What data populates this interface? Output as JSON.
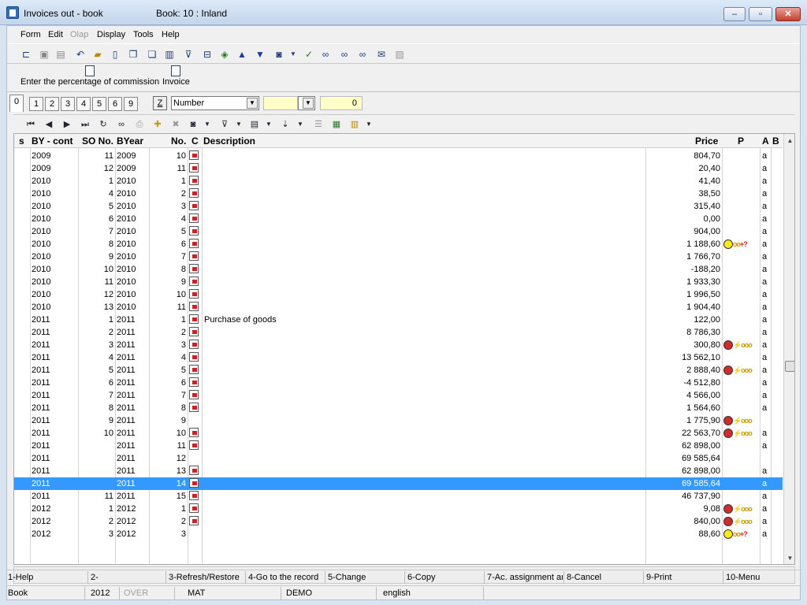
{
  "window": {
    "title": "Invoices out - book",
    "book": "Book: 10 : Inland",
    "min": "‒",
    "max": "▫",
    "close": "✕"
  },
  "menu": {
    "form": "Form",
    "edit": "Edit",
    "olap": "Olap",
    "display": "Display",
    "tools": "Tools",
    "help": "Help"
  },
  "actions": {
    "commission": "Enter the percentage of commission",
    "invoice": "Invoice"
  },
  "tabs": [
    "0",
    "1",
    "2",
    "3",
    "4",
    "5",
    "6",
    "9"
  ],
  "filter": {
    "z_label": "Z",
    "sort_field": "Number",
    "search_value": "",
    "counter": "0"
  },
  "columns": {
    "s": "s",
    "by_cont": "BY - cont",
    "so_no": "SO No.",
    "byear": "BYear",
    "no": "No.",
    "c": "C",
    "description": "Description",
    "price": "Price",
    "p": "P",
    "a": "A",
    "b": "B"
  },
  "colors": {
    "selection": "#3399ff",
    "grid_bg": "#ffffff",
    "window_bg": "#f0f0f0"
  },
  "rows": [
    {
      "by": "2009",
      "so": "11",
      "byear": "2009",
      "no": "10",
      "c": true,
      "desc": "",
      "price": "804,70",
      "p": "",
      "a": "a",
      "sel": false
    },
    {
      "by": "2009",
      "so": "12",
      "byear": "2009",
      "no": "11",
      "c": true,
      "desc": "",
      "price": "20,40",
      "p": "",
      "a": "a",
      "sel": false
    },
    {
      "by": "2010",
      "so": "1",
      "byear": "2010",
      "no": "1",
      "c": true,
      "desc": "",
      "price": "41,40",
      "p": "",
      "a": "a",
      "sel": false
    },
    {
      "by": "2010",
      "so": "4",
      "byear": "2010",
      "no": "2",
      "c": true,
      "desc": "",
      "price": "38,50",
      "p": "",
      "a": "a",
      "sel": false
    },
    {
      "by": "2010",
      "so": "5",
      "byear": "2010",
      "no": "3",
      "c": true,
      "desc": "",
      "price": "315,40",
      "p": "",
      "a": "a",
      "sel": false
    },
    {
      "by": "2010",
      "so": "6",
      "byear": "2010",
      "no": "4",
      "c": true,
      "desc": "",
      "price": "0,00",
      "p": "",
      "a": "a",
      "sel": false
    },
    {
      "by": "2010",
      "so": "7",
      "byear": "2010",
      "no": "5",
      "c": true,
      "desc": "",
      "price": "904,00",
      "p": "",
      "a": "a",
      "sel": false
    },
    {
      "by": "2010",
      "so": "8",
      "byear": "2010",
      "no": "6",
      "c": true,
      "desc": "",
      "price": "1 188,60",
      "p": "ok",
      "a": "a",
      "sel": false
    },
    {
      "by": "2010",
      "so": "9",
      "byear": "2010",
      "no": "7",
      "c": true,
      "desc": "",
      "price": "1 766,70",
      "p": "",
      "a": "a",
      "sel": false
    },
    {
      "by": "2010",
      "so": "10",
      "byear": "2010",
      "no": "8",
      "c": true,
      "desc": "",
      "price": "-188,20",
      "p": "",
      "a": "a",
      "sel": false
    },
    {
      "by": "2010",
      "so": "11",
      "byear": "2010",
      "no": "9",
      "c": true,
      "desc": "",
      "price": "1 933,30",
      "p": "",
      "a": "a",
      "sel": false
    },
    {
      "by": "2010",
      "so": "12",
      "byear": "2010",
      "no": "10",
      "c": true,
      "desc": "",
      "price": "1 996,50",
      "p": "",
      "a": "a",
      "sel": false
    },
    {
      "by": "2010",
      "so": "13",
      "byear": "2010",
      "no": "11",
      "c": true,
      "desc": "",
      "price": "1 904,40",
      "p": "",
      "a": "a",
      "sel": false
    },
    {
      "by": "2011",
      "so": "1",
      "byear": "2011",
      "no": "1",
      "c": true,
      "desc": "Purchase of goods",
      "price": "122,00",
      "p": "",
      "a": "a",
      "sel": false
    },
    {
      "by": "2011",
      "so": "2",
      "byear": "2011",
      "no": "2",
      "c": true,
      "desc": "",
      "price": "8 786,30",
      "p": "",
      "a": "a",
      "sel": false
    },
    {
      "by": "2011",
      "so": "3",
      "byear": "2011",
      "no": "3",
      "c": true,
      "desc": "",
      "price": "300,80",
      "p": "sad",
      "a": "a",
      "sel": false
    },
    {
      "by": "2011",
      "so": "4",
      "byear": "2011",
      "no": "4",
      "c": true,
      "desc": "",
      "price": "13 562,10",
      "p": "",
      "a": "a",
      "sel": false
    },
    {
      "by": "2011",
      "so": "5",
      "byear": "2011",
      "no": "5",
      "c": true,
      "desc": "",
      "price": "2 888,40",
      "p": "sad",
      "a": "a",
      "sel": false
    },
    {
      "by": "2011",
      "so": "6",
      "byear": "2011",
      "no": "6",
      "c": true,
      "desc": "",
      "price": "-4 512,80",
      "p": "",
      "a": "a",
      "sel": false
    },
    {
      "by": "2011",
      "so": "7",
      "byear": "2011",
      "no": "7",
      "c": true,
      "desc": "",
      "price": "4 566,00",
      "p": "",
      "a": "a",
      "sel": false
    },
    {
      "by": "2011",
      "so": "8",
      "byear": "2011",
      "no": "8",
      "c": true,
      "desc": "",
      "price": "1 564,60",
      "p": "",
      "a": "a",
      "sel": false
    },
    {
      "by": "2011",
      "so": "9",
      "byear": "2011",
      "no": "9",
      "c": false,
      "desc": "",
      "price": "1 775,90",
      "p": "sad",
      "a": "",
      "sel": false
    },
    {
      "by": "2011",
      "so": "10",
      "byear": "2011",
      "no": "10",
      "c": true,
      "desc": "",
      "price": "22 563,70",
      "p": "sad",
      "a": "a",
      "sel": false
    },
    {
      "by": "2011",
      "so": "",
      "byear": "2011",
      "no": "11",
      "c": true,
      "desc": "",
      "price": "62 898,00",
      "p": "",
      "a": "a",
      "sel": false
    },
    {
      "by": "2011",
      "so": "",
      "byear": "2011",
      "no": "12",
      "c": false,
      "desc": "",
      "price": "69 585,64",
      "p": "",
      "a": "",
      "sel": false
    },
    {
      "by": "2011",
      "so": "",
      "byear": "2011",
      "no": "13",
      "c": true,
      "desc": "",
      "price": "62 898,00",
      "p": "",
      "a": "a",
      "sel": false
    },
    {
      "by": "2011",
      "so": "",
      "byear": "2011",
      "no": "14",
      "c": true,
      "desc": "",
      "price": "69 585,64",
      "p": "",
      "a": "a",
      "sel": true
    },
    {
      "by": "2011",
      "so": "11",
      "byear": "2011",
      "no": "15",
      "c": true,
      "desc": "",
      "price": "46 737,90",
      "p": "",
      "a": "a",
      "sel": false
    },
    {
      "by": "2012",
      "so": "1",
      "byear": "2012",
      "no": "1",
      "c": true,
      "desc": "",
      "price": "9,08",
      "p": "sad",
      "a": "a",
      "sel": false
    },
    {
      "by": "2012",
      "so": "2",
      "byear": "2012",
      "no": "2",
      "c": true,
      "desc": "",
      "price": "840,00",
      "p": "sad",
      "a": "a",
      "sel": false
    },
    {
      "by": "2012",
      "so": "3",
      "byear": "2012",
      "no": "3",
      "c": false,
      "desc": "",
      "price": "88,60",
      "p": "ok",
      "a": "a",
      "sel": false
    }
  ],
  "fkeys": [
    "1-Help",
    "2-",
    "3-Refresh/Restore",
    "4-Go to the record",
    "5-Change",
    "6-Copy",
    "7-Ac. assignment ar",
    "8-Cancel",
    "9-Print",
    "10-Menu"
  ],
  "status": {
    "module": "Book",
    "year": "2012",
    "over": "OVER",
    "user": "MAT",
    "db": "DEMO",
    "lang": "english"
  }
}
